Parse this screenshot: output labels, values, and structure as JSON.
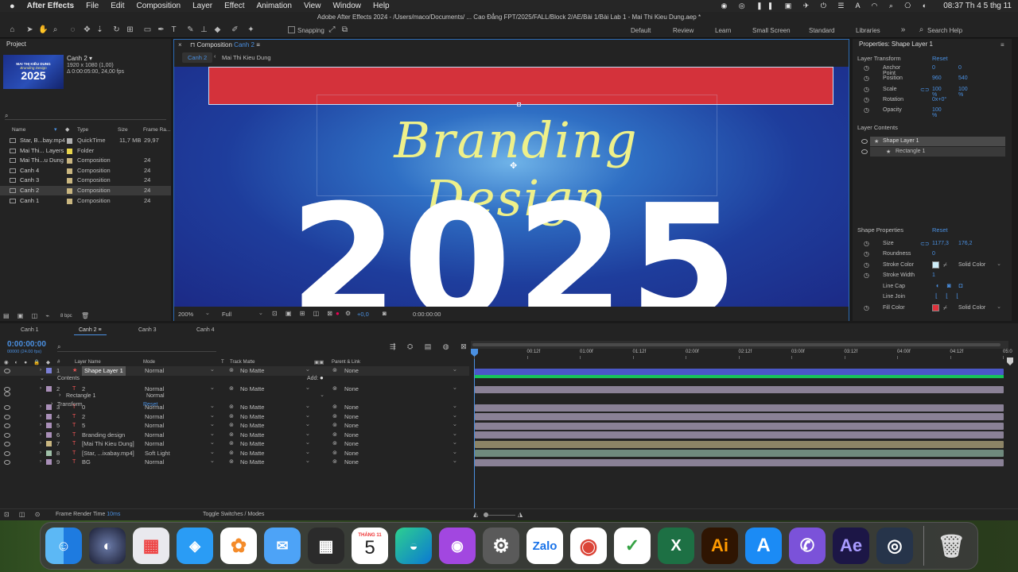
{
  "menubar": {
    "app": "After Effects",
    "items": [
      "File",
      "Edit",
      "Composition",
      "Layer",
      "Effect",
      "Animation",
      "View",
      "Window",
      "Help"
    ],
    "clock": "08:37 Th 4 5 thg 11"
  },
  "titlebar": {
    "text": "Adobe After Effects 2024 - /Users/maco/Documents/ ... Cao Đẳng FPT/2025/FALL/Block 2/AE/Bài 1/Bài Lab 1 - Mai Thi Kieu Dung.aep *"
  },
  "toolbar": {
    "snapping": "Snapping",
    "workspaces": [
      "Default",
      "Review",
      "Learn",
      "Small Screen",
      "Standard",
      "Libraries"
    ],
    "search": "Search Help"
  },
  "project": {
    "title": "Project",
    "comp_name": "Canh 2 ▾",
    "comp_size": "1920 x 1080 (1,00)",
    "comp_duration": "Δ 0:00:05:00, 24,00 fps",
    "thumb_line1": "MAI THỊ KIỀU DUNG",
    "thumb_line2": "Branding Design",
    "thumb_year": "2025",
    "cols": {
      "name": "Name",
      "type": "Type",
      "size": "Size",
      "fps": "Frame Ra..."
    },
    "items": [
      {
        "name": "Star, B...bay.mp4",
        "type": "QuickTime",
        "size": "11,7 MB",
        "fps": "29,97",
        "color": "#b0b0b0"
      },
      {
        "name": "Mai Thi... Layers",
        "type": "Folder",
        "size": "",
        "fps": "",
        "color": "#e8d44d"
      },
      {
        "name": "Mai Thi...u Dung",
        "type": "Composition",
        "size": "",
        "fps": "24",
        "color": "#c9b680"
      },
      {
        "name": "Canh 4",
        "type": "Composition",
        "size": "",
        "fps": "24",
        "color": "#c9b680"
      },
      {
        "name": "Canh 3",
        "type": "Composition",
        "size": "",
        "fps": "24",
        "color": "#c9b680"
      },
      {
        "name": "Canh 2",
        "type": "Composition",
        "size": "",
        "fps": "24",
        "color": "#c9b680"
      },
      {
        "name": "Canh 1",
        "type": "Composition",
        "size": "",
        "fps": "24",
        "color": "#c9b680"
      }
    ],
    "bpc": "8 bpc"
  },
  "comp": {
    "tab_prefix": "Composition",
    "tab_name": "Canh 2",
    "breadcrumb1": "Canh 2",
    "breadcrumb2": "Mai Thi Kieu Dung",
    "title_text": "Branding Design",
    "year": "2025",
    "zoom": "200%",
    "quality": "Full",
    "exposure": "+0,0",
    "timecode": "0:00:00:00"
  },
  "props": {
    "title": "Properties: Shape Layer 1",
    "layer_transform": "Layer Transform",
    "reset": "Reset",
    "transform": [
      {
        "label": "Anchor Point",
        "v1": "0",
        "v2": "0"
      },
      {
        "label": "Position",
        "v1": "960",
        "v2": "540"
      },
      {
        "label": "Scale",
        "v1": "100 %",
        "v2": "100 %"
      },
      {
        "label": "Rotation",
        "v1": "0x+0°",
        "v2": ""
      },
      {
        "label": "Opacity",
        "v1": "100 %",
        "v2": ""
      }
    ],
    "layer_contents": "Layer Contents",
    "content_items": [
      "Shape Layer 1",
      "Rectangle 1"
    ],
    "shape_props": "Shape Properties",
    "size": {
      "label": "Size",
      "v1": "1177,3",
      "v2": "176,2"
    },
    "roundness": {
      "label": "Roundness",
      "v": "0"
    },
    "stroke_color": {
      "label": "Stroke Color",
      "mode": "Solid Color",
      "color": "#cfeefa"
    },
    "stroke_width": {
      "label": "Stroke Width",
      "v": "1"
    },
    "line_cap": "Line Cap",
    "line_join": "Line Join",
    "fill_color": {
      "label": "Fill Color",
      "mode": "Solid Color",
      "color": "#e0323c"
    }
  },
  "timeline": {
    "tabs": [
      "Canh 1",
      "Canh 2",
      "Canh 3",
      "Canh 4"
    ],
    "timecode": "0:00:00:00",
    "fps_note": "00000 (24.00 fps)",
    "cols": {
      "num": "#",
      "name": "Layer Name",
      "mode": "Mode",
      "t": "T",
      "track": "Track Matte",
      "parent": "Parent & Link"
    },
    "ticks": [
      "0f",
      "00:12f",
      "01:00f",
      "01:12f",
      "02:00f",
      "02:12f",
      "03:00f",
      "03:12f",
      "04:00f",
      "04:12f",
      "05:0"
    ],
    "layers": [
      {
        "n": "1",
        "name": "Shape Layer 1",
        "mode": "Normal",
        "matte": "No Matte",
        "parent": "None",
        "color": "#7b7fd6",
        "bar": "#4a58c8"
      },
      {
        "n": "2",
        "name": "2",
        "mode": "Normal",
        "matte": "No Matte",
        "parent": "None",
        "color": "#a98fb8",
        "bar": "#8a8196"
      },
      {
        "n": "3",
        "name": "0",
        "mode": "Normal",
        "matte": "No Matte",
        "parent": "None",
        "color": "#a98fb8",
        "bar": "#8a8196"
      },
      {
        "n": "4",
        "name": "2",
        "mode": "Normal",
        "matte": "No Matte",
        "parent": "None",
        "color": "#a98fb8",
        "bar": "#8a8196"
      },
      {
        "n": "5",
        "name": "5",
        "mode": "Normal",
        "matte": "No Matte",
        "parent": "None",
        "color": "#a98fb8",
        "bar": "#8a8196"
      },
      {
        "n": "6",
        "name": "Branding design",
        "mode": "Normal",
        "matte": "No Matte",
        "parent": "None",
        "color": "#a98fb8",
        "bar": "#8a8196"
      },
      {
        "n": "7",
        "name": "[Mai Thi Kieu Dung]",
        "mode": "Normal",
        "matte": "No Matte",
        "parent": "None",
        "color": "#c9b680",
        "bar": "#8c8466"
      },
      {
        "n": "8",
        "name": "[Star, ...ixabay.mp4]",
        "mode": "Soft Light",
        "matte": "No Matte",
        "parent": "None",
        "color": "#9fc0a8",
        "bar": "#6f8a7d"
      },
      {
        "n": "9",
        "name": "BG",
        "mode": "Normal",
        "matte": "No Matte",
        "parent": "None",
        "color": "#a98fb8",
        "bar": "#8a8196"
      }
    ],
    "contents": "Contents",
    "add": "Add:",
    "rect": "Rectangle 1",
    "rect_mode": "Normal",
    "transform": "Transform",
    "reset": "Reset",
    "render_label": "Frame Render Time",
    "render_val": "10ms",
    "toggle": "Toggle Switches / Modes"
  },
  "dock": {
    "cal_month": "THÁNG 11",
    "cal_day": "5",
    "zalo": "Zalo",
    "ai": "Ai",
    "ae": "Ae"
  }
}
